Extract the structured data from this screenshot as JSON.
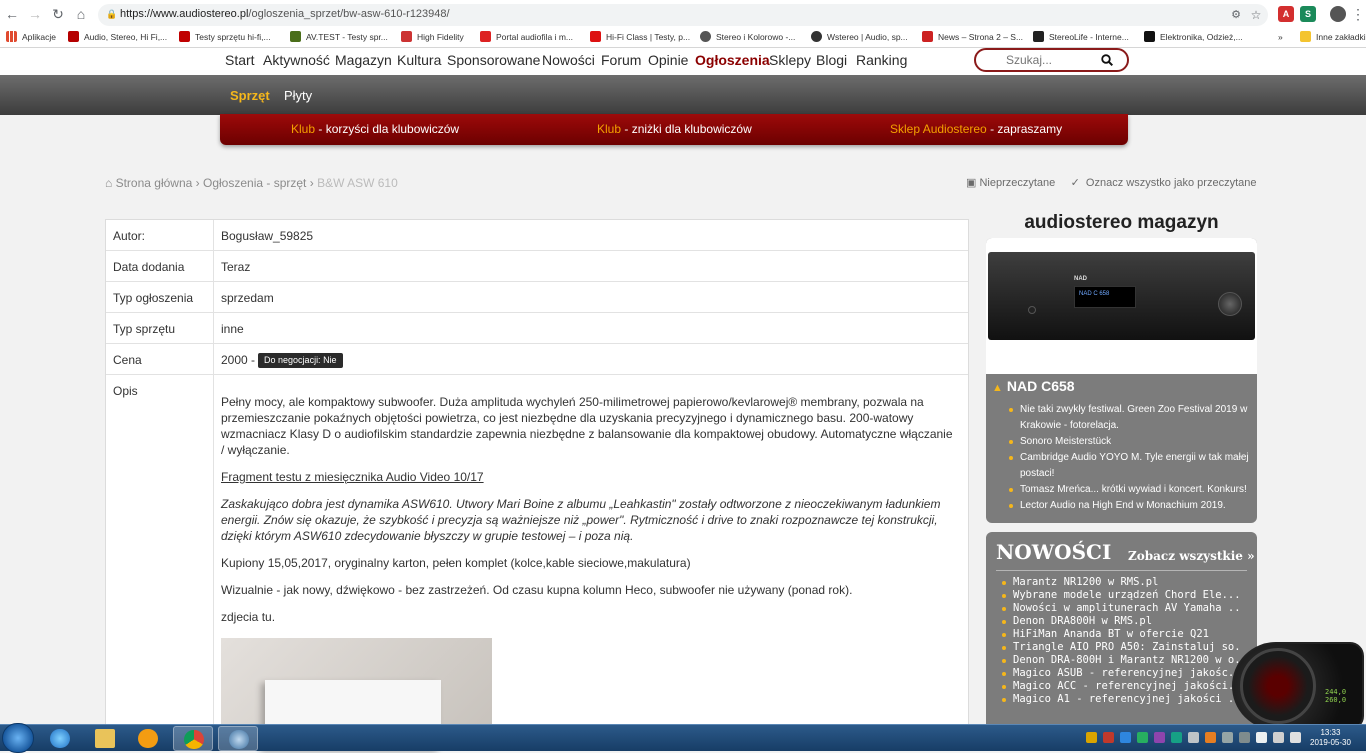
{
  "browser": {
    "url_host": "https://www.audiostereo.pl",
    "url_path": "/ogloszenia_sprzet/bw-asw-610-r123948/",
    "bookmarks": [
      {
        "label": "Aplikacje",
        "color": "#e04a2f"
      },
      {
        "label": "Audio, Stereo, Hi Fi,...",
        "color": "#b50000"
      },
      {
        "label": "Testy sprzętu hi-fi,...",
        "color": "#c00000"
      },
      {
        "label": "AV.TEST - Testy spr...",
        "color": "#4a6e1a"
      },
      {
        "label": "High Fidelity",
        "color": "#c33"
      },
      {
        "label": "Portal audiofila i m...",
        "color": "#d22"
      },
      {
        "label": "Hi-Fi Class | Testy, p...",
        "color": "#d11"
      },
      {
        "label": "Stereo i Kolorowo -...",
        "color": "#555"
      },
      {
        "label": "Wstereo | Audio, sp...",
        "color": "#333"
      },
      {
        "label": "News – Strona 2 – S...",
        "color": "#c22"
      },
      {
        "label": "StereoLife - Interne...",
        "color": "#222"
      },
      {
        "label": "Elektronika, Odzież,...",
        "color": "#111"
      },
      {
        "label": "Inne zakładki",
        "color": "#f4c430"
      }
    ]
  },
  "nav": {
    "items": [
      "Start",
      "Aktywność",
      "Magazyn",
      "Kultura",
      "Sponsorowane",
      "Nowości",
      "Forum",
      "Opinie",
      "Ogłoszenia",
      "Sklepy",
      "Blogi",
      "Ranking"
    ],
    "active": "Ogłoszenia",
    "search_placeholder": "Szukaj..."
  },
  "subnav": {
    "items": [
      "Sprzęt",
      "Płyty"
    ],
    "active": "Sprzęt"
  },
  "promo": [
    {
      "hl": "Klub",
      "sep": " - ",
      "text": "korzyści dla klubowiczów"
    },
    {
      "hl": "Klub",
      "sep": " - ",
      "text": "zniżki dla klubowiczów"
    },
    {
      "hl": "Sklep Audiostereo",
      "sep": " - ",
      "text": "zapraszamy"
    }
  ],
  "breadcrumb": {
    "home": "Strona główna",
    "section": "Ogłoszenia - sprzęt",
    "current": "B&W ASW 610",
    "sep": "›"
  },
  "actions": {
    "unread": "Nieprzeczytane",
    "mark_all": "Oznacz wszystko jako przeczytane"
  },
  "listing": {
    "rows": [
      {
        "label": "Autor:",
        "value": "Bogusław_59825"
      },
      {
        "label": "Data dodania",
        "value": "Teraz"
      },
      {
        "label": "Typ ogłoszenia",
        "value": "sprzedam"
      },
      {
        "label": "Typ sprzętu",
        "value": "inne"
      },
      {
        "label": "Cena",
        "value": "2000 -"
      },
      {
        "label": "Opis",
        "value": ""
      }
    ],
    "negotiation_badge": "Do negocjacji: Nie",
    "description": {
      "p1": "Pełny mocy, ale kompaktowy subwoofer. Duża amplituda wychyleń 250-milimetrowej papierowo/kevlarowej® membrany, pozwala na przemieszczanie pokaźnych objętości powietrza, co jest niezbędne dla uzyskania precyzyjnego i dynamicznego basu. 200-watowy wzmacniacz Klasy D o audiofilskim standardzie zapewnia niezbędne z balansowanie dla kompaktowej obudowy. Automatyczne włączanie / wyłączanie.",
      "link": "Fragment testu z miesięcznika Audio Video 10/17",
      "quote": "Zaskakująco dobra jest dynamika ASW610. Utwory Mari Boine z albumu „Leahkastin\" zostały odtworzone z nieoczekiwanym ładunkiem energii. Znów się okazuje, że szybkość i precyzja są ważniejsze niż „power\". Rytmiczność i drive to znaki rozpoznawcze tej konstrukcji, dzięki którym ASW610 zdecydowanie błyszczy w grupie testowej – i poza nią.",
      "p2": "Kupiony 15,05,2017, oryginalny karton, pełen komplet (kolce,kable sieciowe,makulatura)",
      "p3": "Wizualnie - jak nowy, dźwiękowo - bez zastrzeżeń.  Od czasu kupna kolumn Heco, subwoofer nie używany (ponad rok).",
      "p4": "zdjecia tu."
    }
  },
  "sidebar": {
    "title": "audiostereo magazyn",
    "amp_display": "NAD C 658",
    "amp_brand": "NAD",
    "headline": "NAD C658",
    "articles": [
      "Nie taki zwykły festiwal. Green Zoo Festival 2019 w Krakowie - fotorelacja.",
      "Sonoro Meisterstück",
      "Cambridge Audio YOYO M. Tyle energii w tak małej postaci!",
      "Tomasz Mreńca... krótki wywiad i koncert. Konkurs!",
      "Lector Audio na High End w Monachium 2019."
    ],
    "news_title": "NOWOŚCI",
    "news_all": "Zobacz wszystkie »",
    "news": [
      "Marantz NR1200 w RMS.pl",
      "Wybrane modele urządzeń Chord Ele...",
      "Nowości w amplitunerach AV Yamaha ...",
      "Denon DRA800H w RMS.pl",
      "HiFiMan Ananda BT w ofercie Q21",
      "Triangle AIO PRO A50: Zainstaluj so...",
      "Denon DRA-800H i Marantz NR1200 w o...",
      "Magico ASUB - referencyjnej jakośc...",
      "Magico ACC - referencyjnej jakości...",
      "Magico A1 - referencyjnej jakości ..."
    ]
  },
  "gauge": {
    "line1": "244,0",
    "line2": "260,0"
  },
  "taskbar": {
    "time": "13:33",
    "date": "2019-05-30"
  }
}
